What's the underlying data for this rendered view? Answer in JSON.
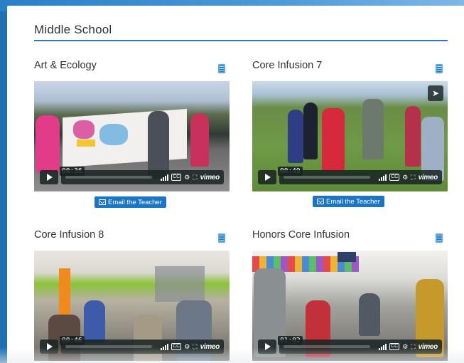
{
  "section": {
    "title": "Middle School"
  },
  "cards": [
    {
      "title": "Art & Ecology",
      "timecode": "00:36",
      "player_brand": "vimeo",
      "cc": "CC",
      "email_label": "Email the Teacher"
    },
    {
      "title": "Core Infusion 7",
      "timecode": "00:49",
      "player_brand": "vimeo",
      "cc": "CC",
      "email_label": "Email the Teacher"
    },
    {
      "title": "Core Infusion 8",
      "timecode": "00:46",
      "player_brand": "vimeo",
      "cc": "CC"
    },
    {
      "title": "Honors Core Infusion",
      "timecode": "01:02",
      "player_brand": "vimeo",
      "cc": "CC"
    }
  ],
  "colors": {
    "accent": "#1b75c6",
    "rule": "#2f79b9",
    "frame": "#1f6fb3"
  }
}
